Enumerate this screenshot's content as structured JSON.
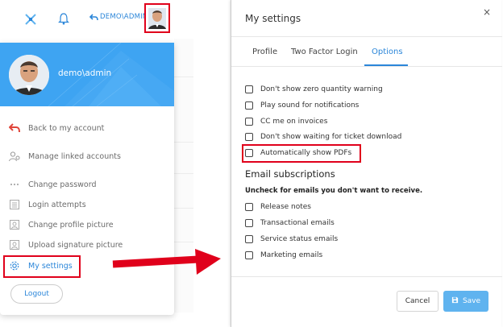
{
  "topbar": {
    "user_label": "DEMO\\ADMIN"
  },
  "account_menu": {
    "username": "demo\\admin",
    "items": [
      {
        "label": "Back to my account",
        "icon": "back-arrow-icon"
      },
      {
        "label": "Manage linked accounts",
        "icon": "linked-users-icon"
      },
      {
        "label": "Change password",
        "icon": "password-dots-icon"
      },
      {
        "label": "Login attempts",
        "icon": "list-icon"
      },
      {
        "label": "Change profile picture",
        "icon": "profile-picture-icon"
      },
      {
        "label": "Upload signature picture",
        "icon": "signature-picture-icon"
      },
      {
        "label": "My settings",
        "icon": "gear-icon"
      }
    ],
    "logout_label": "Logout"
  },
  "settings_modal": {
    "title": "My settings",
    "close_label": "×",
    "tabs": [
      {
        "label": "Profile",
        "active": false
      },
      {
        "label": "Two Factor Login",
        "active": false
      },
      {
        "label": "Options",
        "active": true
      }
    ],
    "options": [
      {
        "label": "Don't show zero quantity warning",
        "checked": false
      },
      {
        "label": "Play sound for notifications",
        "checked": false
      },
      {
        "label": "CC me on invoices",
        "checked": false
      },
      {
        "label": "Don't show waiting for ticket download",
        "checked": false
      },
      {
        "label": "Automatically show PDFs",
        "checked": false
      }
    ],
    "email_section_title": "Email subscriptions",
    "email_section_desc": "Uncheck for emails you don't want to receive.",
    "email_options": [
      {
        "label": "Release notes",
        "checked": false
      },
      {
        "label": "Transactional emails",
        "checked": false
      },
      {
        "label": "Service status emails",
        "checked": false
      },
      {
        "label": "Marketing emails",
        "checked": false
      }
    ],
    "cancel_label": "Cancel",
    "save_label": "Save"
  },
  "colors": {
    "accent": "#2b86d9",
    "header_blue": "#3ea4f2",
    "highlight_red": "#e0001b",
    "save_button": "#5fb3ef"
  }
}
